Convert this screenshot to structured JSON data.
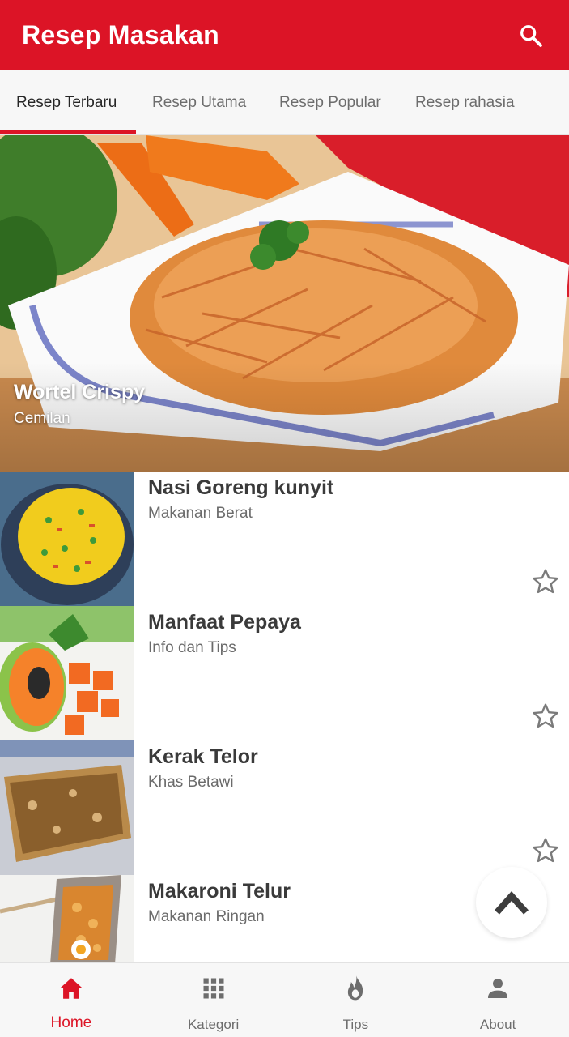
{
  "appbar": {
    "title": "Resep Masakan",
    "search_icon": "search-icon"
  },
  "tabs": [
    {
      "label": "Resep Terbaru",
      "active": true
    },
    {
      "label": "Resep Utama",
      "active": false
    },
    {
      "label": "Resep Popular",
      "active": false
    },
    {
      "label": "Resep rahasia",
      "active": false
    }
  ],
  "hero": {
    "title": "Wortel Crispy",
    "subtitle": "Cemilan"
  },
  "recipes": [
    {
      "title": "Nasi Goreng kunyit",
      "category": "Makanan Berat"
    },
    {
      "title": "Manfaat Pepaya",
      "category": "Info dan Tips"
    },
    {
      "title": "Kerak Telor",
      "category": "Khas Betawi"
    },
    {
      "title": "Makaroni Telur",
      "category": "Makanan Ringan"
    }
  ],
  "bottom_nav": [
    {
      "label": "Home",
      "icon": "home-icon",
      "active": true
    },
    {
      "label": "Kategori",
      "icon": "grid-icon",
      "active": false
    },
    {
      "label": "Tips",
      "icon": "flame-icon",
      "active": false
    },
    {
      "label": "About",
      "icon": "person-icon",
      "active": false
    }
  ],
  "colors": {
    "primary": "#dc1426",
    "text_dark": "#3a3a3a",
    "text_muted": "#6b6b6b",
    "icon_gray": "#7a7a7a"
  }
}
